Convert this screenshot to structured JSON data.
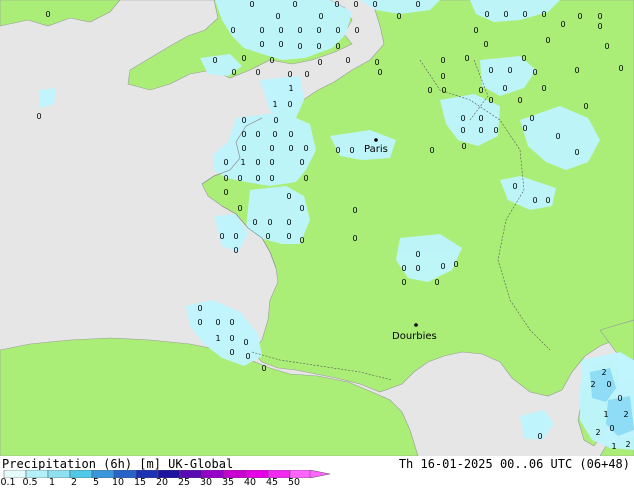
{
  "title": "Precipitation (6h) [m] UK-Global",
  "timestamp": "Th 16-01-2025 00..06 UTC (06+48)",
  "cities": [
    {
      "name": "Paris"
    },
    {
      "name": "Dourbies"
    }
  ],
  "legend": {
    "labels": [
      "0.1",
      "0.5",
      "1",
      "2",
      "5",
      "10",
      "15",
      "20",
      "25",
      "30",
      "35",
      "40",
      "45",
      "50"
    ],
    "colors": [
      "#e6fcfc",
      "#b4f0f8",
      "#8ce0f0",
      "#50c8e8",
      "#3c96dc",
      "#2864c8",
      "#1e32b4",
      "#1e14a0",
      "#5a0ab4",
      "#9600c8",
      "#c800d2",
      "#e600e6",
      "#f028f0",
      "#ff64ff"
    ]
  },
  "marker_values": [
    "0",
    "1",
    "2"
  ],
  "colors": {
    "sea": "#e6e6e6",
    "land": "#aaee77",
    "light_precip": "#bff5ff",
    "medium_precip": "#8edcf5"
  }
}
